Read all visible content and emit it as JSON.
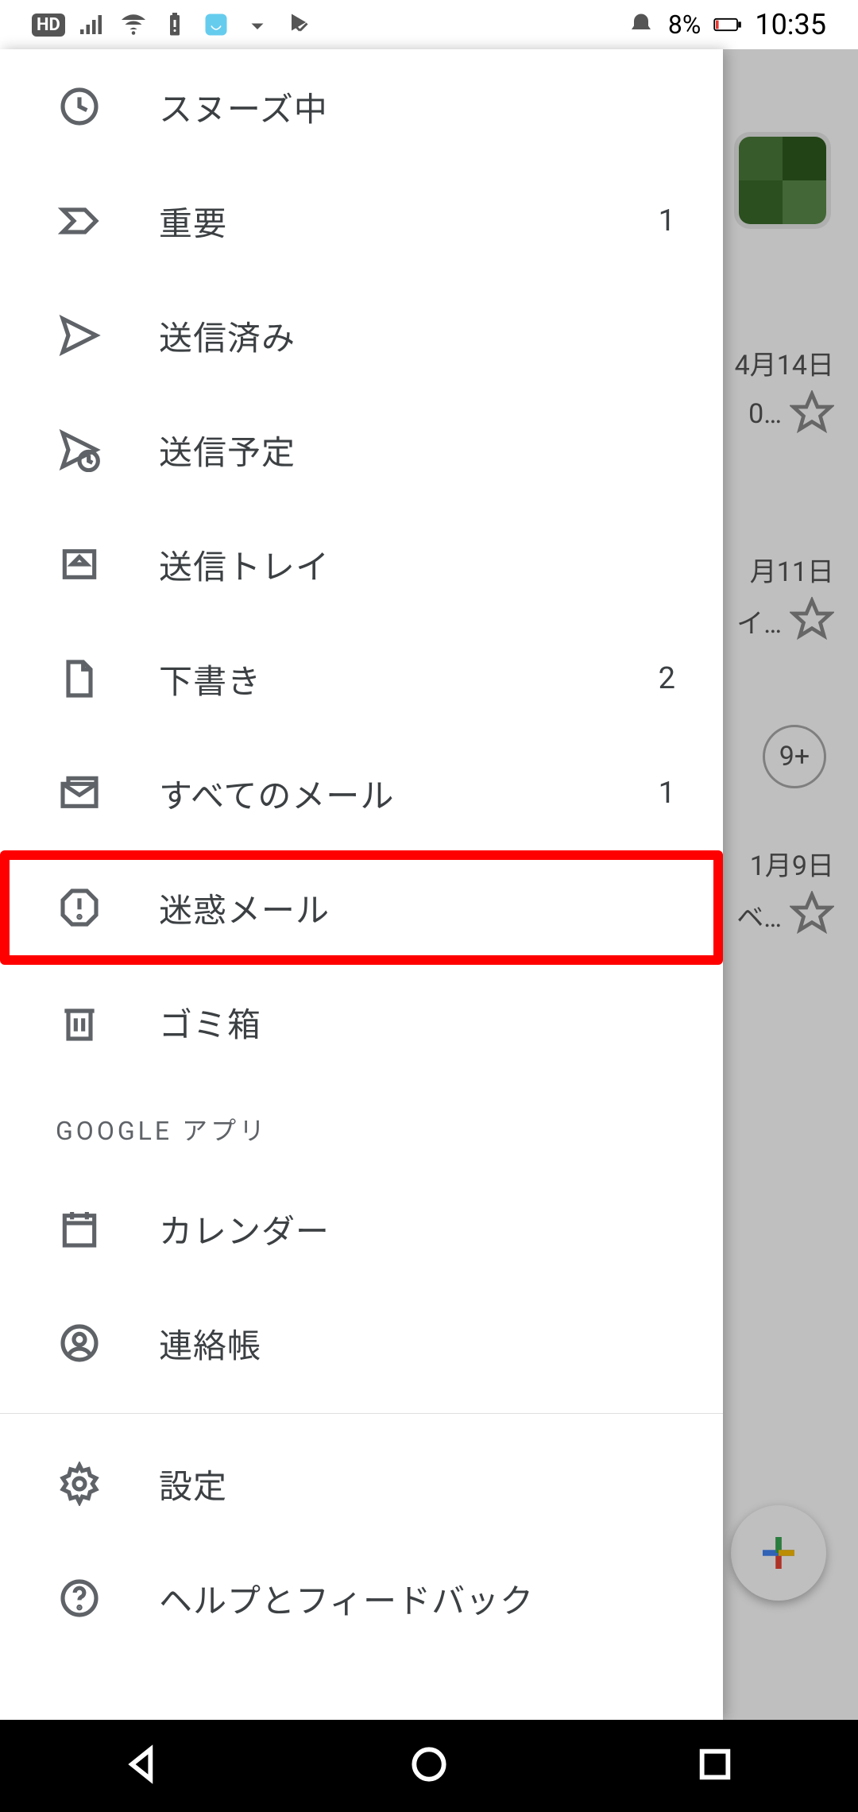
{
  "statusbar": {
    "hd": "HD",
    "battery_text": "8%",
    "clock": "10:35"
  },
  "background": {
    "dates": [
      "4月14日",
      "月11日",
      "1月9日"
    ],
    "preview1": "0…",
    "preview2": "イ…",
    "preview3": "ベ…",
    "badge": "9+"
  },
  "drawer": {
    "items": [
      {
        "label": "スヌーズ中",
        "count": ""
      },
      {
        "label": "重要",
        "count": "1"
      },
      {
        "label": "送信済み",
        "count": ""
      },
      {
        "label": "送信予定",
        "count": ""
      },
      {
        "label": "送信トレイ",
        "count": ""
      },
      {
        "label": "下書き",
        "count": "2"
      },
      {
        "label": "すべてのメール",
        "count": "1"
      },
      {
        "label": "迷惑メール",
        "count": ""
      },
      {
        "label": "ゴミ箱",
        "count": ""
      }
    ],
    "section_google": "GOOGLE アプリ",
    "google_items": [
      {
        "label": "カレンダー"
      },
      {
        "label": "連絡帳"
      }
    ],
    "footer_items": [
      {
        "label": "設定"
      },
      {
        "label": "ヘルプとフィードバック"
      }
    ]
  }
}
